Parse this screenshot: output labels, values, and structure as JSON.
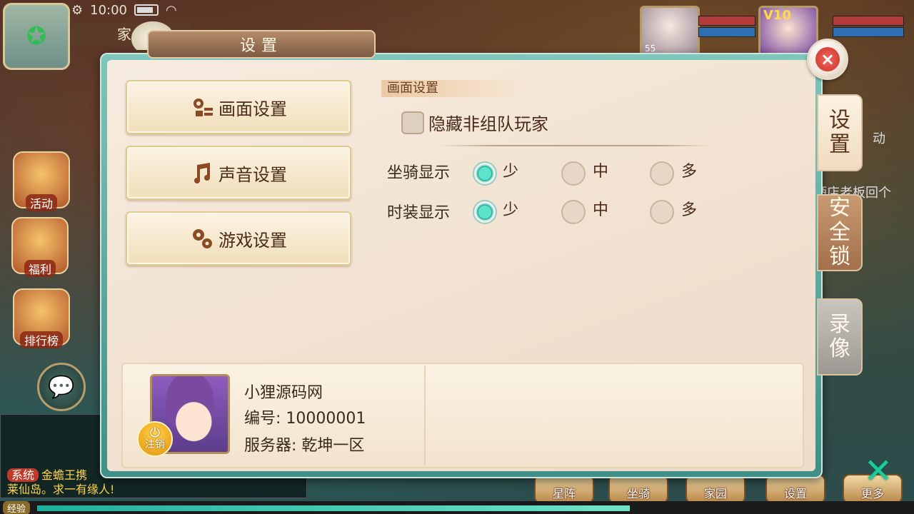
{
  "status_bar": {
    "time": "10:00"
  },
  "hud": {
    "home_tab": "家",
    "left_icons": [
      {
        "label": "活动"
      },
      {
        "label": "福利"
      },
      {
        "label": "排行榜"
      }
    ],
    "players": [
      {
        "level": "55",
        "vip": ""
      },
      {
        "level": "",
        "vip": "V10"
      }
    ],
    "chat": {
      "channel_tag": "系统",
      "line1": "金蟾王携",
      "line2": "莱仙岛。求一有缘人!"
    },
    "exp_label": "经验",
    "exp_progress": 0.68,
    "bottom_buttons": [
      "星阵",
      "坐骑",
      "家园",
      "设置",
      "更多"
    ],
    "right_texts": [
      "动",
      "酒店老板回个"
    ]
  },
  "settings": {
    "title": "设置",
    "close_glyph": "×",
    "menu": [
      {
        "label": "画面设置",
        "icon": "gears-grid-icon"
      },
      {
        "label": "声音设置",
        "icon": "music-note-icon"
      },
      {
        "label": "游戏设置",
        "icon": "gears-icon"
      }
    ],
    "section_title": "画面设置",
    "hide_players": {
      "label": "隐藏非组队玩家",
      "checked": false
    },
    "rows": [
      {
        "label": "坐骑显示",
        "options": [
          "少",
          "中",
          "多"
        ],
        "selected": "少"
      },
      {
        "label": "时装显示",
        "options": [
          "少",
          "中",
          "多"
        ],
        "selected": "少"
      }
    ],
    "side_tabs": [
      {
        "label": "设置",
        "state": "active"
      },
      {
        "label": "安全锁",
        "state": "normal"
      },
      {
        "label": "录像",
        "state": "gray"
      }
    ],
    "profile": {
      "name": "小狸源码网",
      "id_text": "编号: 10000001",
      "server_text": "服务器: 乾坤一区",
      "logout_label": "注销"
    }
  },
  "colors": {
    "accent_teal": "#17a590",
    "text_dark": "#4a2a18",
    "close_red": "#c9302a"
  }
}
